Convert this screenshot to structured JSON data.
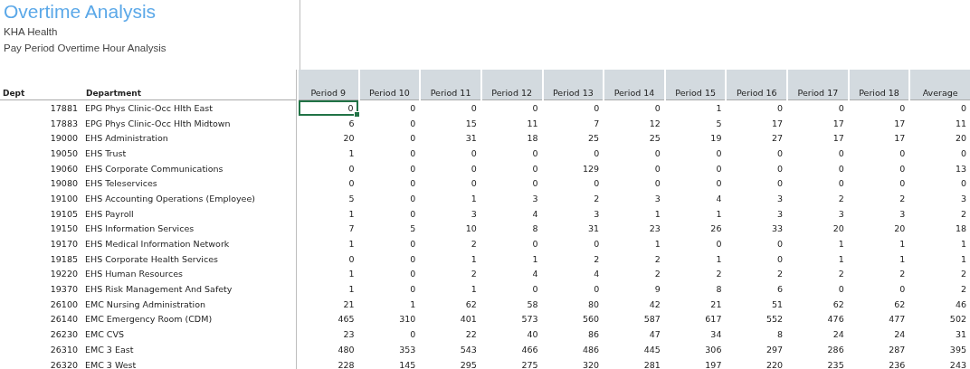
{
  "title": "Overtime Analysis",
  "subtitle": "KHA Health",
  "report_name": "Pay Period Overtime Hour Analysis",
  "table": {
    "columns": [
      "Dept",
      "Department",
      "Period 9",
      "Period 10",
      "Period 11",
      "Period 12",
      "Period 13",
      "Period 14",
      "Period 15",
      "Period 16",
      "Period 17",
      "Period 18",
      "Average"
    ],
    "rows": [
      {
        "dept": "17881",
        "department": "EPG Phys Clinic-Occ Hlth East",
        "cells": [
          {
            "value": "0",
            "selected": true
          },
          {
            "value": "0",
            "selected": false
          },
          {
            "value": "0",
            "selected": false
          },
          {
            "value": "0",
            "selected": false
          },
          {
            "value": "0",
            "selected": false
          },
          {
            "value": "0",
            "selected": false
          },
          {
            "value": "1",
            "selected": false
          },
          {
            "value": "0",
            "selected": false
          },
          {
            "value": "0",
            "selected": false
          },
          {
            "value": "0",
            "selected": false
          },
          {
            "value": "0",
            "selected": false
          }
        ]
      },
      {
        "dept": "17883",
        "department": "EPG Phys Clinic-Occ Hlth Midtown",
        "cells": [
          {
            "value": "6",
            "selected": false
          },
          {
            "value": "0",
            "selected": false
          },
          {
            "value": "15",
            "selected": false
          },
          {
            "value": "11",
            "selected": false
          },
          {
            "value": "7",
            "selected": false
          },
          {
            "value": "12",
            "selected": false
          },
          {
            "value": "5",
            "selected": false
          },
          {
            "value": "17",
            "selected": false
          },
          {
            "value": "17",
            "selected": false
          },
          {
            "value": "17",
            "selected": false
          },
          {
            "value": "11",
            "selected": false
          }
        ]
      },
      {
        "dept": "19000",
        "department": "EHS Administration",
        "cells": [
          {
            "value": "20",
            "selected": false
          },
          {
            "value": "0",
            "selected": false
          },
          {
            "value": "31",
            "selected": false
          },
          {
            "value": "18",
            "selected": false
          },
          {
            "value": "25",
            "selected": false
          },
          {
            "value": "25",
            "selected": false
          },
          {
            "value": "19",
            "selected": false
          },
          {
            "value": "27",
            "selected": false
          },
          {
            "value": "17",
            "selected": false
          },
          {
            "value": "17",
            "selected": false
          },
          {
            "value": "20",
            "selected": false
          }
        ]
      },
      {
        "dept": "19050",
        "department": "EHS Trust",
        "cells": [
          {
            "value": "1",
            "selected": false
          },
          {
            "value": "0",
            "selected": false
          },
          {
            "value": "0",
            "selected": false
          },
          {
            "value": "0",
            "selected": false
          },
          {
            "value": "0",
            "selected": false
          },
          {
            "value": "0",
            "selected": false
          },
          {
            "value": "0",
            "selected": false
          },
          {
            "value": "0",
            "selected": false
          },
          {
            "value": "0",
            "selected": false
          },
          {
            "value": "0",
            "selected": false
          },
          {
            "value": "0",
            "selected": false
          }
        ]
      },
      {
        "dept": "19060",
        "department": "EHS Corporate Communications",
        "cells": [
          {
            "value": "0",
            "selected": false
          },
          {
            "value": "0",
            "selected": false
          },
          {
            "value": "0",
            "selected": false
          },
          {
            "value": "0",
            "selected": false
          },
          {
            "value": "129",
            "selected": false
          },
          {
            "value": "0",
            "selected": false
          },
          {
            "value": "0",
            "selected": false
          },
          {
            "value": "0",
            "selected": false
          },
          {
            "value": "0",
            "selected": false
          },
          {
            "value": "0",
            "selected": false
          },
          {
            "value": "13",
            "selected": false
          }
        ]
      },
      {
        "dept": "19080",
        "department": "EHS Teleservices",
        "cells": [
          {
            "value": "0",
            "selected": false
          },
          {
            "value": "0",
            "selected": false
          },
          {
            "value": "0",
            "selected": false
          },
          {
            "value": "0",
            "selected": false
          },
          {
            "value": "0",
            "selected": false
          },
          {
            "value": "0",
            "selected": false
          },
          {
            "value": "0",
            "selected": false
          },
          {
            "value": "0",
            "selected": false
          },
          {
            "value": "0",
            "selected": false
          },
          {
            "value": "0",
            "selected": false
          },
          {
            "value": "0",
            "selected": false
          }
        ]
      },
      {
        "dept": "19100",
        "department": "EHS Accounting Operations (Employee)",
        "cells": [
          {
            "value": "5",
            "selected": false
          },
          {
            "value": "0",
            "selected": false
          },
          {
            "value": "1",
            "selected": false
          },
          {
            "value": "3",
            "selected": false
          },
          {
            "value": "2",
            "selected": false
          },
          {
            "value": "3",
            "selected": false
          },
          {
            "value": "4",
            "selected": false
          },
          {
            "value": "3",
            "selected": false
          },
          {
            "value": "2",
            "selected": false
          },
          {
            "value": "2",
            "selected": false
          },
          {
            "value": "3",
            "selected": false
          }
        ]
      },
      {
        "dept": "19105",
        "department": "EHS Payroll",
        "cells": [
          {
            "value": "1",
            "selected": false
          },
          {
            "value": "0",
            "selected": false
          },
          {
            "value": "3",
            "selected": false
          },
          {
            "value": "4",
            "selected": false
          },
          {
            "value": "3",
            "selected": false
          },
          {
            "value": "1",
            "selected": false
          },
          {
            "value": "1",
            "selected": false
          },
          {
            "value": "3",
            "selected": false
          },
          {
            "value": "3",
            "selected": false
          },
          {
            "value": "3",
            "selected": false
          },
          {
            "value": "2",
            "selected": false
          }
        ]
      },
      {
        "dept": "19150",
        "department": "EHS Information Services",
        "cells": [
          {
            "value": "7",
            "selected": false
          },
          {
            "value": "5",
            "selected": false
          },
          {
            "value": "10",
            "selected": false
          },
          {
            "value": "8",
            "selected": false
          },
          {
            "value": "31",
            "selected": false
          },
          {
            "value": "23",
            "selected": false
          },
          {
            "value": "26",
            "selected": false
          },
          {
            "value": "33",
            "selected": false
          },
          {
            "value": "20",
            "selected": false
          },
          {
            "value": "20",
            "selected": false
          },
          {
            "value": "18",
            "selected": false
          }
        ]
      },
      {
        "dept": "19170",
        "department": "EHS Medical Information Network",
        "cells": [
          {
            "value": "1",
            "selected": false
          },
          {
            "value": "0",
            "selected": false
          },
          {
            "value": "2",
            "selected": false
          },
          {
            "value": "0",
            "selected": false
          },
          {
            "value": "0",
            "selected": false
          },
          {
            "value": "1",
            "selected": false
          },
          {
            "value": "0",
            "selected": false
          },
          {
            "value": "0",
            "selected": false
          },
          {
            "value": "1",
            "selected": false
          },
          {
            "value": "1",
            "selected": false
          },
          {
            "value": "1",
            "selected": false
          }
        ]
      },
      {
        "dept": "19185",
        "department": "EHS Corporate Health Services",
        "cells": [
          {
            "value": "0",
            "selected": false
          },
          {
            "value": "0",
            "selected": false
          },
          {
            "value": "1",
            "selected": false
          },
          {
            "value": "1",
            "selected": false
          },
          {
            "value": "2",
            "selected": false
          },
          {
            "value": "2",
            "selected": false
          },
          {
            "value": "1",
            "selected": false
          },
          {
            "value": "0",
            "selected": false
          },
          {
            "value": "1",
            "selected": false
          },
          {
            "value": "1",
            "selected": false
          },
          {
            "value": "1",
            "selected": false
          }
        ]
      },
      {
        "dept": "19220",
        "department": "EHS Human Resources",
        "cells": [
          {
            "value": "1",
            "selected": false
          },
          {
            "value": "0",
            "selected": false
          },
          {
            "value": "2",
            "selected": false
          },
          {
            "value": "4",
            "selected": false
          },
          {
            "value": "4",
            "selected": false
          },
          {
            "value": "2",
            "selected": false
          },
          {
            "value": "2",
            "selected": false
          },
          {
            "value": "2",
            "selected": false
          },
          {
            "value": "2",
            "selected": false
          },
          {
            "value": "2",
            "selected": false
          },
          {
            "value": "2",
            "selected": false
          }
        ]
      },
      {
        "dept": "19370",
        "department": "EHS Risk Management And Safety",
        "cells": [
          {
            "value": "1",
            "selected": false
          },
          {
            "value": "0",
            "selected": false
          },
          {
            "value": "1",
            "selected": false
          },
          {
            "value": "0",
            "selected": false
          },
          {
            "value": "0",
            "selected": false
          },
          {
            "value": "9",
            "selected": false
          },
          {
            "value": "8",
            "selected": false
          },
          {
            "value": "6",
            "selected": false
          },
          {
            "value": "0",
            "selected": false
          },
          {
            "value": "0",
            "selected": false
          },
          {
            "value": "2",
            "selected": false
          }
        ]
      },
      {
        "dept": "26100",
        "department": "EMC Nursing Administration",
        "cells": [
          {
            "value": "21",
            "selected": false
          },
          {
            "value": "1",
            "selected": false
          },
          {
            "value": "62",
            "selected": false
          },
          {
            "value": "58",
            "selected": false
          },
          {
            "value": "80",
            "selected": false
          },
          {
            "value": "42",
            "selected": false
          },
          {
            "value": "21",
            "selected": false
          },
          {
            "value": "51",
            "selected": false
          },
          {
            "value": "62",
            "selected": false
          },
          {
            "value": "62",
            "selected": false
          },
          {
            "value": "46",
            "selected": false
          }
        ]
      },
      {
        "dept": "26140",
        "department": "EMC Emergency Room (CDM)",
        "cells": [
          {
            "value": "465",
            "selected": false
          },
          {
            "value": "310",
            "selected": false
          },
          {
            "value": "401",
            "selected": false
          },
          {
            "value": "573",
            "selected": false
          },
          {
            "value": "560",
            "selected": false
          },
          {
            "value": "587",
            "selected": false
          },
          {
            "value": "617",
            "selected": false
          },
          {
            "value": "552",
            "selected": false
          },
          {
            "value": "476",
            "selected": false
          },
          {
            "value": "477",
            "selected": false
          },
          {
            "value": "502",
            "selected": false
          }
        ]
      },
      {
        "dept": "26230",
        "department": "EMC CVS",
        "cells": [
          {
            "value": "23",
            "selected": false
          },
          {
            "value": "0",
            "selected": false
          },
          {
            "value": "22",
            "selected": false
          },
          {
            "value": "40",
            "selected": false
          },
          {
            "value": "86",
            "selected": false
          },
          {
            "value": "47",
            "selected": false
          },
          {
            "value": "34",
            "selected": false
          },
          {
            "value": "8",
            "selected": false
          },
          {
            "value": "24",
            "selected": false
          },
          {
            "value": "24",
            "selected": false
          },
          {
            "value": "31",
            "selected": false
          }
        ]
      },
      {
        "dept": "26310",
        "department": "EMC 3 East",
        "cells": [
          {
            "value": "480",
            "selected": false
          },
          {
            "value": "353",
            "selected": false
          },
          {
            "value": "543",
            "selected": false
          },
          {
            "value": "466",
            "selected": false
          },
          {
            "value": "486",
            "selected": false
          },
          {
            "value": "445",
            "selected": false
          },
          {
            "value": "306",
            "selected": false
          },
          {
            "value": "297",
            "selected": false
          },
          {
            "value": "286",
            "selected": false
          },
          {
            "value": "287",
            "selected": false
          },
          {
            "value": "395",
            "selected": false
          }
        ]
      },
      {
        "dept": "26320",
        "department": "EMC 3 West",
        "cells": [
          {
            "value": "228",
            "selected": false
          },
          {
            "value": "145",
            "selected": false
          },
          {
            "value": "295",
            "selected": false
          },
          {
            "value": "275",
            "selected": false
          },
          {
            "value": "320",
            "selected": false
          },
          {
            "value": "281",
            "selected": false
          },
          {
            "value": "197",
            "selected": false
          },
          {
            "value": "220",
            "selected": false
          },
          {
            "value": "235",
            "selected": false
          },
          {
            "value": "236",
            "selected": false
          },
          {
            "value": "243",
            "selected": false
          }
        ]
      }
    ]
  }
}
